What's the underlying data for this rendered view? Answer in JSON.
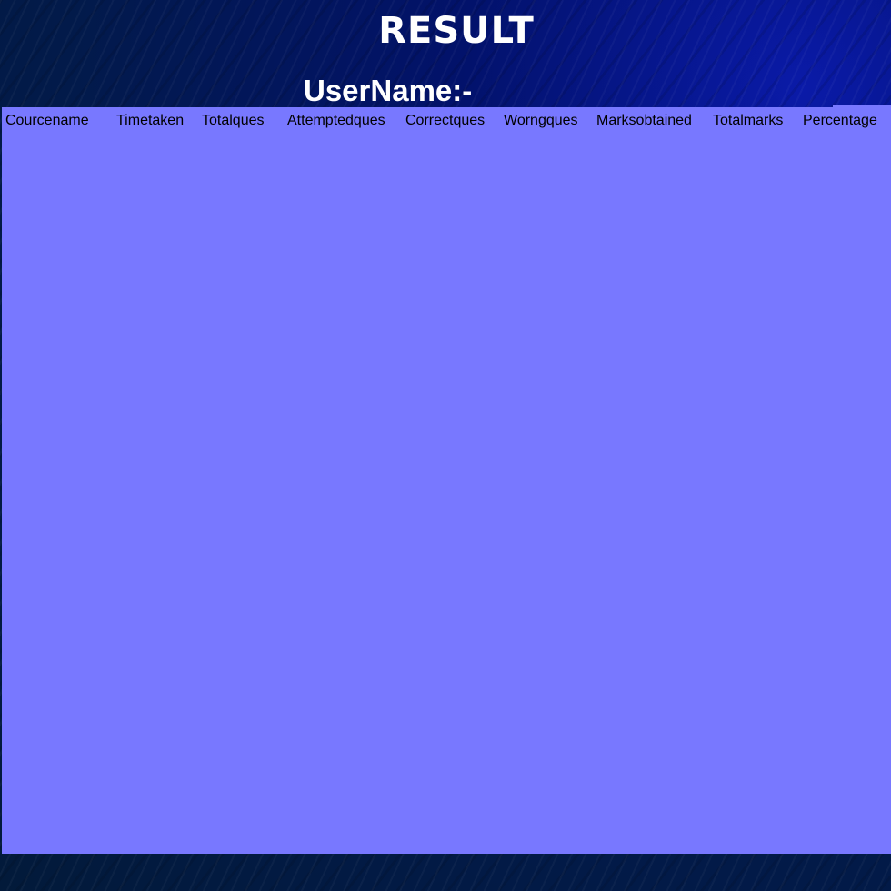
{
  "page": {
    "title": "RESULT",
    "username_label": "UserName:-"
  },
  "table": {
    "columns": [
      "Courcename",
      "Timetaken",
      "Totalques",
      "Attemptedques",
      "Correctques",
      "Worngques",
      "Marksobtained",
      "Totalmarks",
      "Percentage"
    ],
    "rows": []
  },
  "colors": {
    "background": "#021a4a",
    "panel": "#7878ff",
    "heading_text": "#ffffff",
    "table_text": "#000000"
  }
}
